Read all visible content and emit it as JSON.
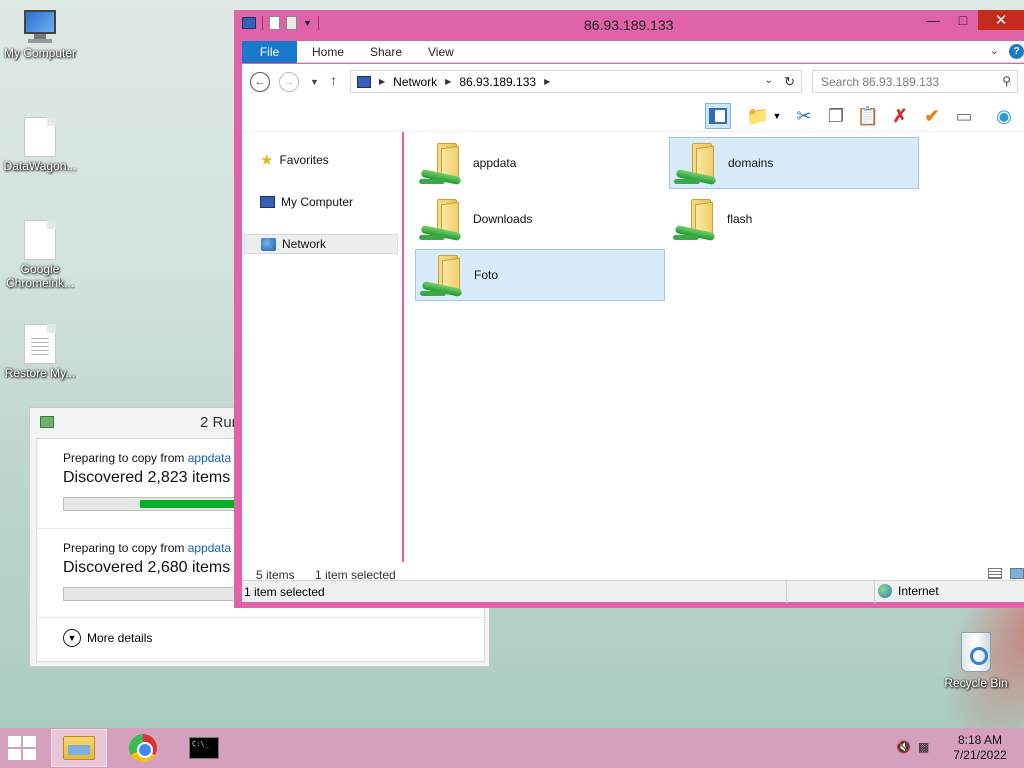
{
  "desktop": {
    "icons": [
      {
        "label": "My Computer"
      },
      {
        "label": "DataWagon..."
      },
      {
        "label": "Google Chromelnk..."
      },
      {
        "label": "Restore My..."
      }
    ],
    "recycle_bin": "Recycle Bin"
  },
  "copy_dialog": {
    "title": "2 Run",
    "items": [
      {
        "prefix": "Preparing to copy from ",
        "source": "appdata",
        "discovered": "Discovered 2,823 items (",
        "progress": 0.5
      },
      {
        "prefix": "Preparing to copy from ",
        "source": "appdata",
        "discovered": "Discovered 2,680 items (",
        "progress": 0.0
      }
    ],
    "more_details": "More details"
  },
  "explorer": {
    "title": "86.93.189.133",
    "ribbon_tabs": [
      "File",
      "Home",
      "Share",
      "View"
    ],
    "address": [
      "Network",
      "86.93.189.133"
    ],
    "search_placeholder": "Search 86.93.189.133",
    "nav": [
      {
        "label": "Favorites",
        "icon": "star-icon"
      },
      {
        "label": "My Computer",
        "icon": "computer-icon"
      },
      {
        "label": "Network",
        "icon": "network-icon",
        "selected": true
      }
    ],
    "folders": [
      {
        "name": "appdata",
        "selected": false
      },
      {
        "name": "domains",
        "selected": true
      },
      {
        "name": "Downloads",
        "selected": false
      },
      {
        "name": "flash",
        "selected": false
      },
      {
        "name": "Foto",
        "selected": true
      }
    ],
    "status": {
      "count": "5 items",
      "selected": "1 item selected"
    },
    "statusbar": {
      "left": "1 item selected",
      "zone": "Internet"
    }
  },
  "taskbar": {
    "time": "8:18 AM",
    "date": "7/21/2022"
  },
  "colors": {
    "window_frame": "#e062a8",
    "file_tab": "#1979ca",
    "selection": "#d9ebf9",
    "progress": "#06b025",
    "taskbar": "#d4a0bd",
    "close": "#c42b1c"
  }
}
